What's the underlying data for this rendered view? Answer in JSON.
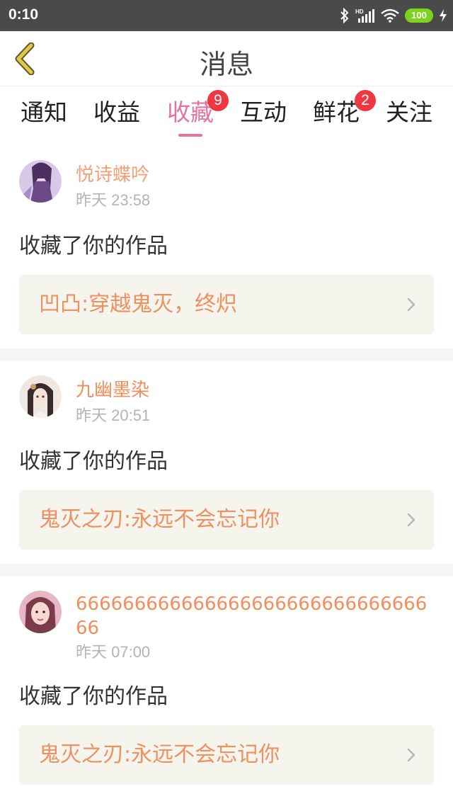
{
  "status_bar": {
    "time": "0:10",
    "battery": "100",
    "icons": [
      "bluetooth-icon",
      "hd-signal-icon",
      "wifi-icon",
      "battery-icon",
      "charging-icon"
    ]
  },
  "header": {
    "title": "消息",
    "back_icon": "chevron-left-icon"
  },
  "colors": {
    "accent_pink": "#e6739f",
    "name_orange": "#f08f5b",
    "badge_red": "#f0373f",
    "back_yellow": "#e3c64a"
  },
  "tabs": [
    {
      "label": "通知",
      "badge": ""
    },
    {
      "label": "收益",
      "badge": ""
    },
    {
      "label": "收藏",
      "badge": "9",
      "active": true
    },
    {
      "label": "互动",
      "badge": ""
    },
    {
      "label": "鲜花",
      "badge": "2"
    },
    {
      "label": "关注",
      "badge": ""
    }
  ],
  "messages": [
    {
      "username": "悦诗蝶吟",
      "time": "昨天 23:58",
      "action": "收藏了你的作品",
      "work_title": "凹凸:穿越鬼灭，终炽"
    },
    {
      "username": "九幽墨染",
      "time": "昨天 20:51",
      "action": "收藏了你的作品",
      "work_title": "鬼灭之刃:永远不会忘记你"
    },
    {
      "username": "66666666666666666666666666666666",
      "time": "昨天 07:00",
      "action": "收藏了你的作品",
      "work_title": "鬼灭之刃:永远不会忘记你"
    }
  ]
}
